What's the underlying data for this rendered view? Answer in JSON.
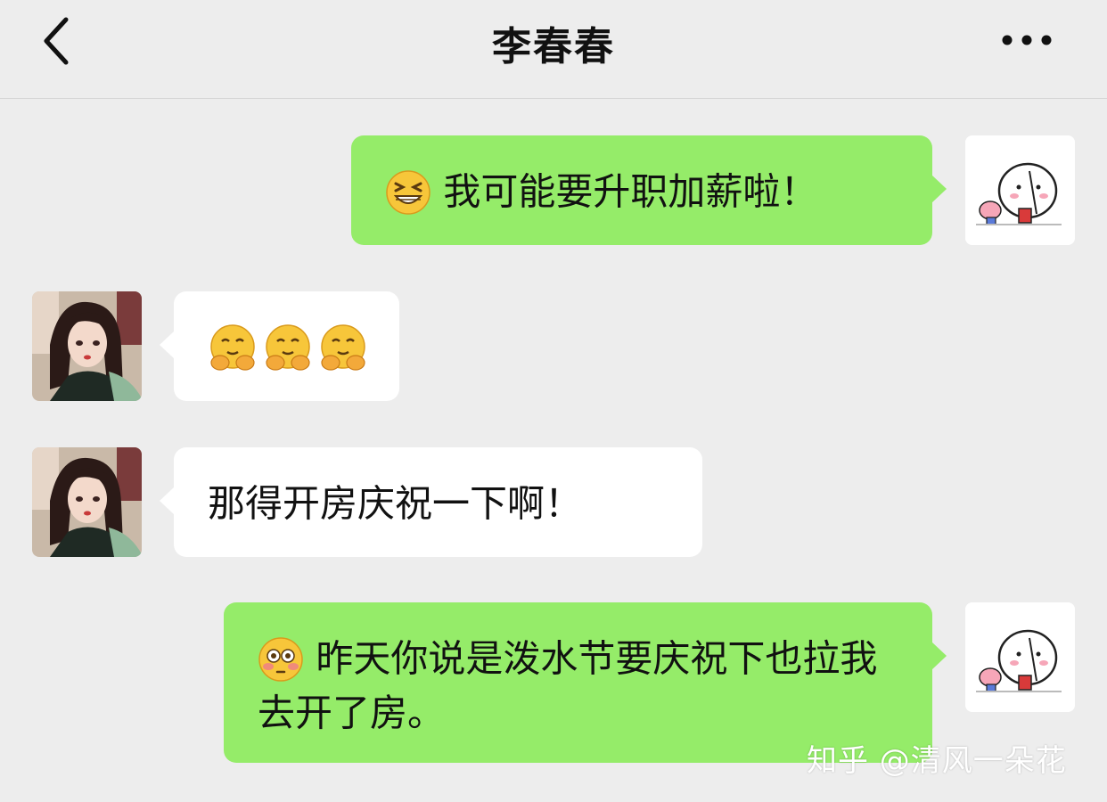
{
  "header": {
    "title": "李春春"
  },
  "messages": [
    {
      "side": "right",
      "emoji": "grinning-squint-emoji",
      "text": "我可能要升职加薪啦！"
    },
    {
      "side": "left",
      "emoji": "hugging-face-emoji",
      "text": ""
    },
    {
      "side": "left",
      "text": "那得开房庆祝一下啊！"
    },
    {
      "side": "right",
      "emoji": "flushed-face-emoji",
      "text": "昨天你说是泼水节要庆祝下也拉我去开了房。"
    }
  ],
  "watermark": "知乎 @清风一朵花",
  "colors": {
    "background": "#ededed",
    "sent_bubble": "#95ec69",
    "received_bubble": "#ffffff"
  }
}
